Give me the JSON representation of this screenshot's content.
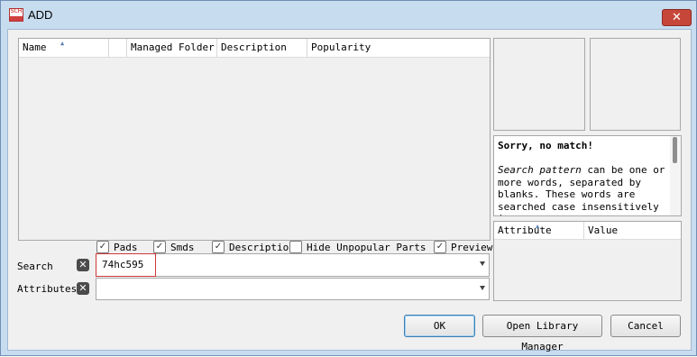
{
  "window": {
    "title": "ADD",
    "app_icon_text": "SCH",
    "close_icon": "close-icon"
  },
  "results": {
    "columns": [
      "Name",
      "Managed Folder",
      "Description",
      "Popularity"
    ],
    "sorted_column": "Name"
  },
  "message": {
    "title": "Sorry, no match!",
    "body_em": "Search pattern",
    "body_rest": " can be one or more words, separated by blanks. These words are searched case insensitively in"
  },
  "attributes_table": {
    "columns": [
      "Attribute",
      "Value"
    ]
  },
  "options": {
    "pads": {
      "label": "Pads",
      "checked": true
    },
    "smds": {
      "label": "Smds",
      "checked": true
    },
    "description": {
      "label": "Description",
      "checked": true
    },
    "hide_unpopular": {
      "label": "Hide Unpopular Parts",
      "checked": false
    },
    "preview": {
      "label": "Preview",
      "checked": true
    }
  },
  "search": {
    "label": "Search",
    "value": "74hc595"
  },
  "attributes": {
    "label": "Attributes",
    "value": ""
  },
  "buttons": {
    "ok": "OK",
    "open_library_manager": "Open Library Manager",
    "cancel": "Cancel"
  }
}
